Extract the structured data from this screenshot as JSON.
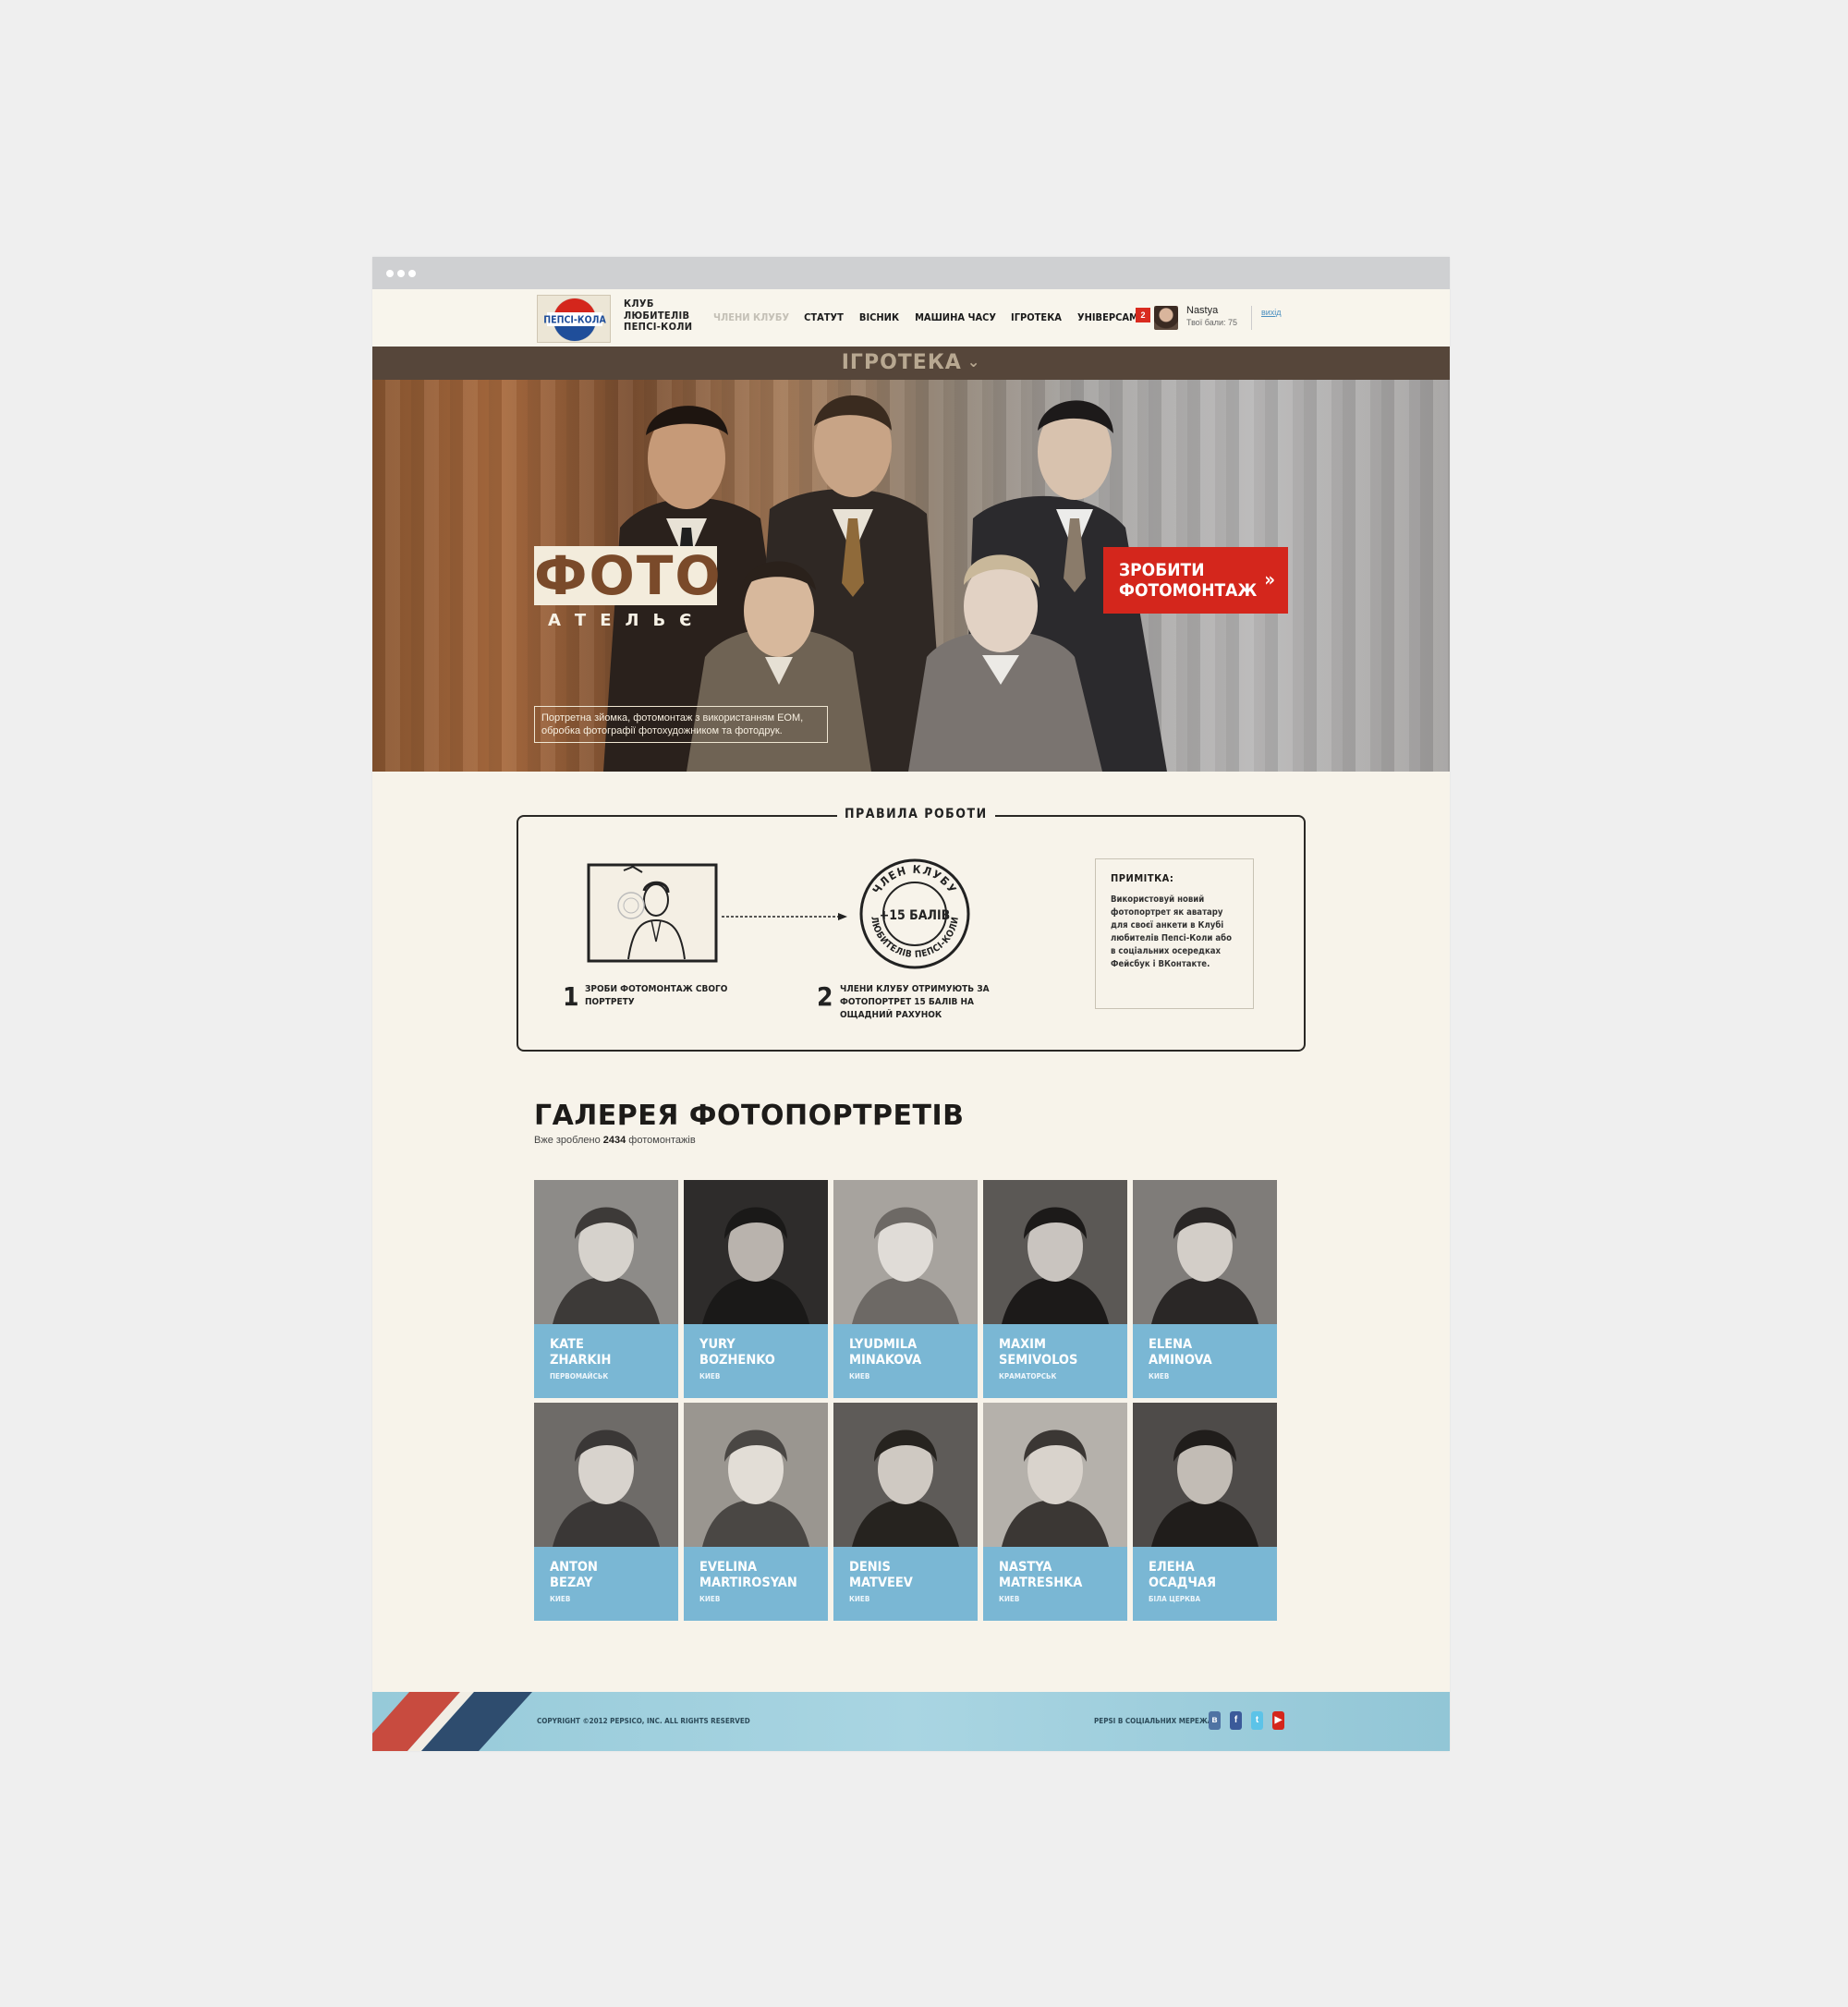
{
  "header": {
    "logo_text": "ПЕПСІ-КОЛА",
    "club_name_lines": [
      "КЛУБ",
      "ЛЮБИТЕЛІВ",
      "ПЕПСІ-КОЛИ"
    ],
    "nav": [
      {
        "label": "ЧЛЕНИ КЛУБУ",
        "active": false
      },
      {
        "label": "СТАТУТ",
        "active": true
      },
      {
        "label": "ВІСНИК",
        "active": true
      },
      {
        "label": "МАШИНА ЧАСУ",
        "active": true
      },
      {
        "label": "ІГРОТЕКА",
        "active": true
      },
      {
        "label": "УНІВЕРСАМ",
        "active": true
      }
    ],
    "notifications": "2",
    "user_name": "Nastya",
    "user_points": "Твої бали: 75",
    "logout": "вихід"
  },
  "section_bar": {
    "label": "ІГРОТЕКА"
  },
  "hero": {
    "title": "ФОТО",
    "subtitle": "АТЕЛЬЄ",
    "cta": [
      "ЗРОБИТИ",
      "ФОТОМОНТАЖ"
    ],
    "description_lines": [
      "Портретна зйомка, фотомонтаж з використанням ЕОМ,",
      "обробка фотографії фотохудожником та фотодрук."
    ]
  },
  "rules": {
    "title": "ПРАВИЛА РОБОТИ",
    "steps": [
      {
        "num": "1",
        "text_lines": [
          "ЗРОБИ ФОТОМОНТАЖ СВОГО",
          "ПОРТРЕТУ"
        ]
      },
      {
        "num": "2",
        "text_lines": [
          "ЧЛЕНИ КЛУБУ ОТРИМУЮТЬ ЗА",
          "ФОТОПОРТРЕТ 15 БАЛІВ НА",
          "ОЩАДНИЙ РАХУНОК"
        ]
      }
    ],
    "stamp_center": "+15 БАЛІВ",
    "stamp_ring_top": "ЧЛЕН КЛУБУ",
    "stamp_ring_bottom": "ЛЮБИТЕЛІВ ПЕПСІ-КОЛИ",
    "note_title": "ПРИМІТКА:",
    "note_lines": [
      "Використовуй новий",
      "фотопортрет як аватару",
      "для своєї анкети в Клубі",
      "любителів Пепсі-Коли або",
      "в соціальних осередках",
      "Фейсбук і ВКонтакте."
    ]
  },
  "gallery": {
    "title": "ГАЛЕРЕЯ ФОТОПОРТРЕТІВ",
    "subtitle_prefix": "Вже зроблено",
    "count": "2434",
    "subtitle_suffix": "фотомонтажів",
    "cards": [
      {
        "first": "KATE",
        "last": "ZHARKIH",
        "city": "ПЕРВОМАЙСЬК"
      },
      {
        "first": "YURY",
        "last": "BOZHENKO",
        "city": "КИЕВ"
      },
      {
        "first": "LYUDMILA",
        "last": "MINAKOVA",
        "city": "КИЕВ"
      },
      {
        "first": "MAXIM",
        "last": "SEMIVOLOS",
        "city": "КРАМАТОРСЬК"
      },
      {
        "first": "ELENA",
        "last": "AMINOVA",
        "city": "КИЕВ"
      },
      {
        "first": "ANTON",
        "last": "BEZAY",
        "city": "КИЕВ"
      },
      {
        "first": "EVELINA",
        "last": "MARTIROSYAN",
        "city": "КИЕВ"
      },
      {
        "first": "DENIS",
        "last": "MATVEEV",
        "city": "КИЕВ"
      },
      {
        "first": "NASTYA",
        "last": "MATRESHKA",
        "city": "КИЕВ"
      },
      {
        "first": "ЕЛЕНА",
        "last": "ОСАДЧАЯ",
        "city": "БІЛА ЦЕРКВА"
      }
    ]
  },
  "footer": {
    "copyright": "COPYRIGHT ©2012 PEPSICO, INC. ALL RIGHTS RESERVED",
    "social_label": "PEPSI В СОЦІАЛЬНИХ МЕРЕЖАХ:",
    "social": [
      {
        "icon": "vkontakte-icon",
        "glyph": "в",
        "color": "#4f73a3"
      },
      {
        "icon": "facebook-icon",
        "glyph": "f",
        "color": "#3b5a9a"
      },
      {
        "icon": "twitter-icon",
        "glyph": "t",
        "color": "#5cc3e8"
      },
      {
        "icon": "youtube-icon",
        "glyph": "▶",
        "color": "#d4261c"
      }
    ]
  },
  "colors": {
    "accent_red": "#d4261c",
    "card_blue": "#7ab7d4",
    "section_bar": "#56463a",
    "page_bg": "#f7f3ea"
  }
}
